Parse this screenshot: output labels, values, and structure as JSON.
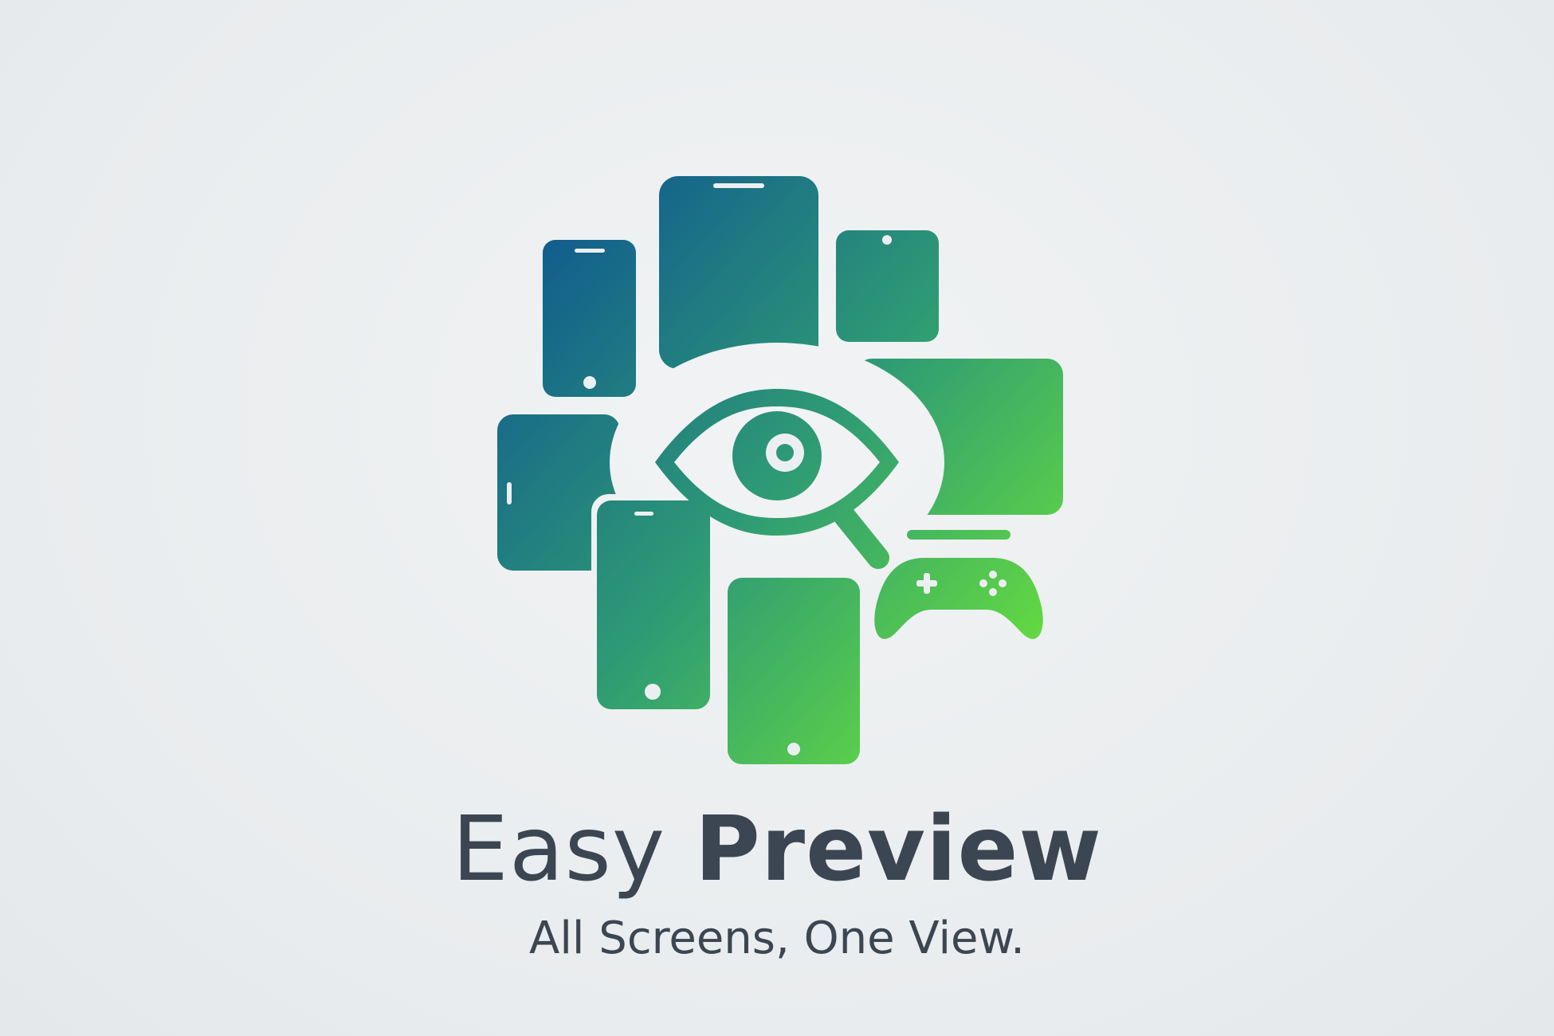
{
  "brand": {
    "name_part1": "Easy",
    "name_part2": "Preview",
    "tagline": "All Screens, One View."
  },
  "logo": {
    "icons": [
      "phone-icon",
      "tablet-icon",
      "monitor-icon",
      "gamepad-icon",
      "eye-icon",
      "magnifier-icon"
    ],
    "gradient_start": "#0b4f93",
    "gradient_end": "#6be23a"
  },
  "colors": {
    "background": "#eceff1",
    "text": "#3b4652"
  }
}
